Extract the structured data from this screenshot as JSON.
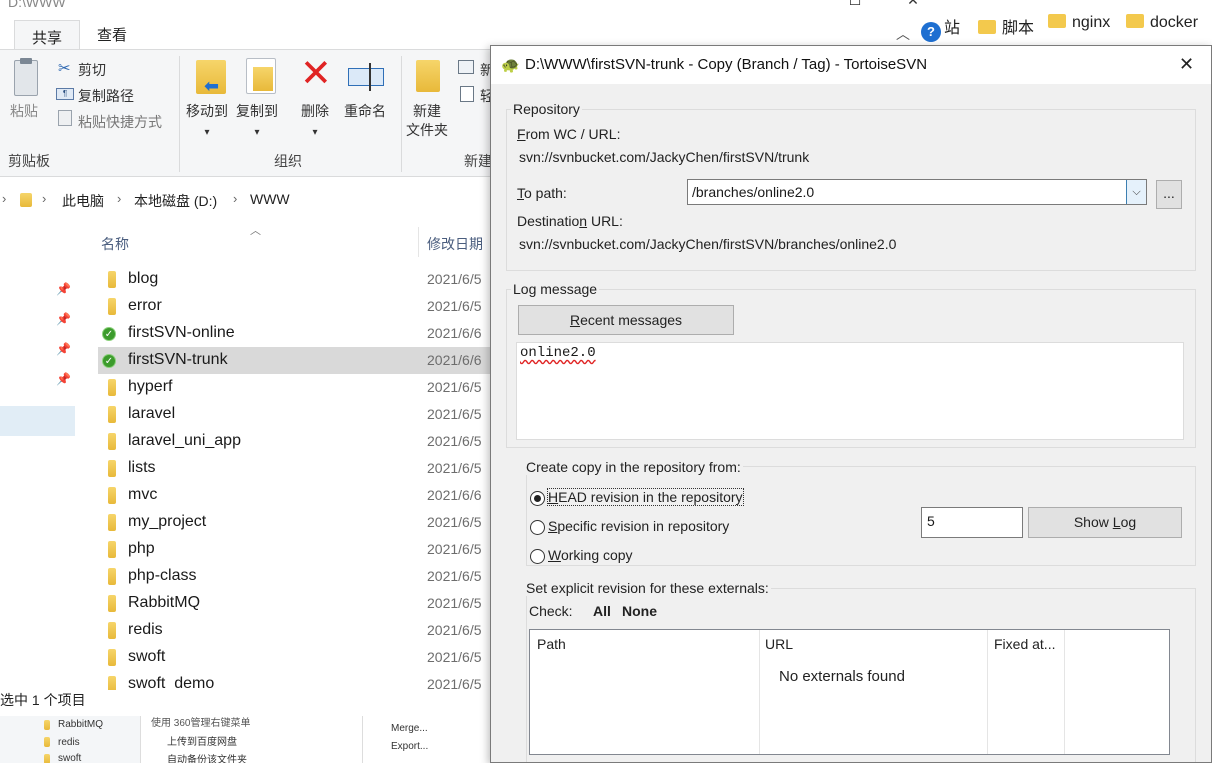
{
  "explorer": {
    "window_title": "D:\\WWW",
    "tabs": [
      "共享",
      "查看"
    ],
    "clipboard": {
      "paste": "粘贴",
      "cut": "剪切",
      "copy_path": "复制路径",
      "paste_shortcut": "粘贴快捷方式",
      "group": "剪贴板"
    },
    "organize": {
      "move_to": "移动到",
      "copy_to": "复制到",
      "delete": "删除",
      "rename": "重命名",
      "group": "组织"
    },
    "new": {
      "new_folder_line1": "新建",
      "new_folder_line2": "文件夹",
      "new_item": "新",
      "easy_access": "轻",
      "group": "新建"
    },
    "breadcrumb": [
      "此电脑",
      "本地磁盘 (D:)",
      "WWW"
    ],
    "columns": {
      "name": "名称",
      "modified": "修改日期"
    },
    "files": [
      {
        "name": "blog",
        "date": "2021/6/5",
        "svn": false
      },
      {
        "name": "error",
        "date": "2021/6/5",
        "svn": false
      },
      {
        "name": "firstSVN-online",
        "date": "2021/6/6",
        "svn": true
      },
      {
        "name": "firstSVN-trunk",
        "date": "2021/6/6",
        "svn": true
      },
      {
        "name": "hyperf",
        "date": "2021/6/5",
        "svn": false
      },
      {
        "name": "laravel",
        "date": "2021/6/5",
        "svn": false
      },
      {
        "name": "laravel_uni_app",
        "date": "2021/6/5",
        "svn": false
      },
      {
        "name": "lists",
        "date": "2021/6/5",
        "svn": false
      },
      {
        "name": "mvc",
        "date": "2021/6/6",
        "svn": false
      },
      {
        "name": "my_project",
        "date": "2021/6/5",
        "svn": false
      },
      {
        "name": "php",
        "date": "2021/6/5",
        "svn": false
      },
      {
        "name": "php-class",
        "date": "2021/6/5",
        "svn": false
      },
      {
        "name": "RabbitMQ",
        "date": "2021/6/5",
        "svn": false
      },
      {
        "name": "redis",
        "date": "2021/6/5",
        "svn": false
      },
      {
        "name": "swoft",
        "date": "2021/6/5",
        "svn": false
      },
      {
        "name": "swoft_demo",
        "date": "2021/6/5",
        "svn": false
      }
    ],
    "status": "选中 1 个项目",
    "background_strip": {
      "items": [
        "RabbitMQ",
        "redis",
        "swoft"
      ],
      "menu": [
        "使用 360管理右键菜单",
        "上传到百度网盘",
        "自动备份该文件夹"
      ],
      "menu_right": [
        "Merge...",
        "Export..."
      ]
    }
  },
  "browser_bookmarks": [
    "站",
    "脚本",
    "nginx",
    "docker"
  ],
  "dialog": {
    "title": "D:\\WWW\\firstSVN-trunk - Copy (Branch / Tag) - TortoiseSVN",
    "repository": {
      "group": "Repository",
      "from_label": "From WC / URL:",
      "from_value": "svn://svnbucket.com/JackyChen/firstSVN/trunk",
      "to_label": "To path:",
      "to_value": "/branches/online2.0",
      "browse": "...",
      "dest_label": "Destination URL:",
      "dest_value": "svn://svnbucket.com/JackyChen/firstSVN/branches/online2.0"
    },
    "log": {
      "group": "Log message",
      "recent_button": "Recent messages",
      "message": "online2.0"
    },
    "create_from": {
      "group": "Create copy in the repository from:",
      "options": [
        "HEAD revision in the repository",
        "Specific revision in repository",
        "Working copy"
      ],
      "selected": 0,
      "revision": "5",
      "show_log": "Show Log"
    },
    "externals": {
      "group": "Set explicit revision for these externals:",
      "check_label": "Check:",
      "all": "All",
      "none": "None",
      "columns": [
        "Path",
        "URL",
        "Fixed at..."
      ],
      "empty": "No externals found"
    }
  },
  "colors": {
    "ribbon_bg": "#f5f6f7",
    "selected_row": "#d9d9d9",
    "dialog_bg": "#f0f0f0",
    "folder": "#f3c94d",
    "svn_ok": "#3c9b2c"
  }
}
